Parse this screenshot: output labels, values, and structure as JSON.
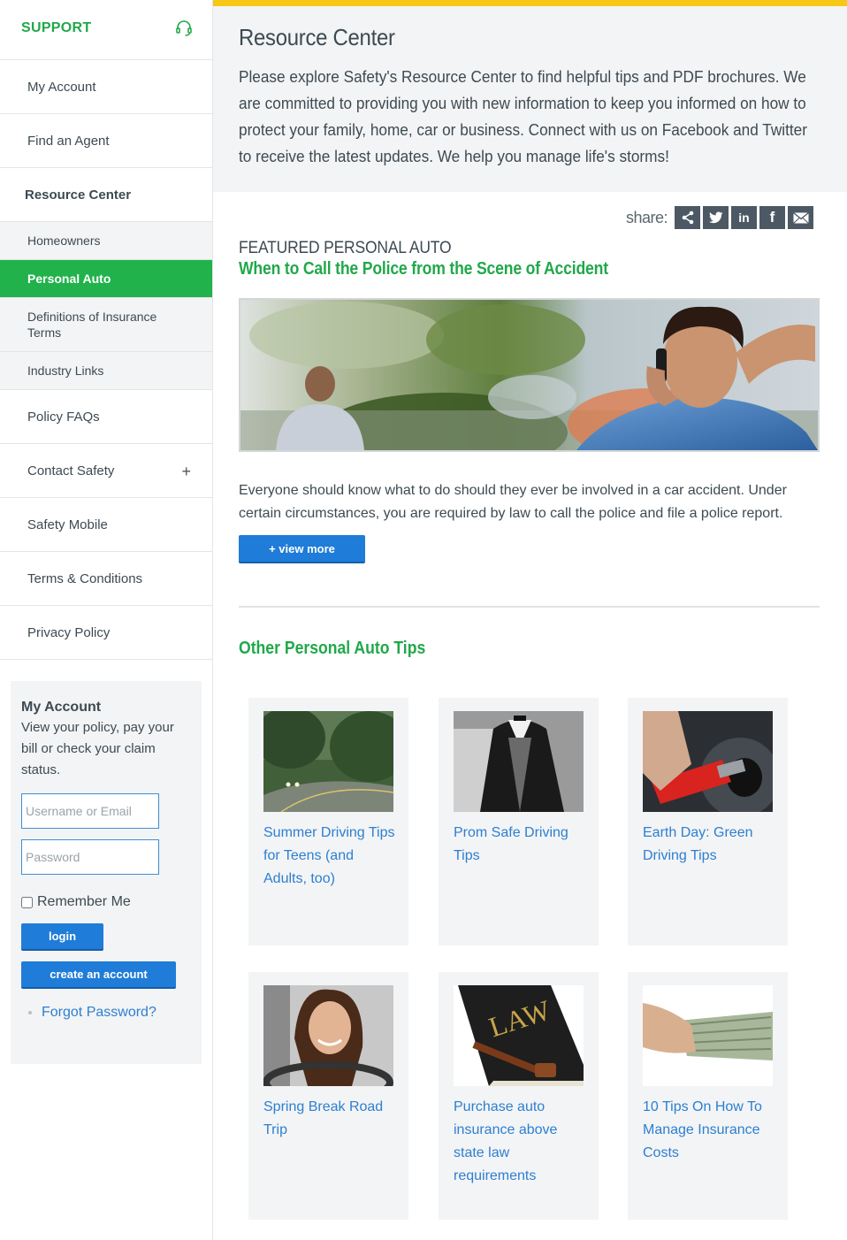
{
  "sidebar": {
    "support_label": "SUPPORT",
    "nav": {
      "my_account": "My Account",
      "find_agent": "Find an Agent",
      "resource_center": "Resource Center",
      "homeowners": "Homeowners",
      "personal_auto": "Personal Auto",
      "definitions": "Definitions of Insurance Terms",
      "industry_links": "Industry Links",
      "policy_faqs": "Policy FAQs",
      "contact_safety": "Contact Safety",
      "contact_expand": "+",
      "safety_mobile": "Safety Mobile",
      "terms": "Terms & Conditions",
      "privacy": "Privacy Policy"
    },
    "account": {
      "title": "My Account",
      "description": "View your policy, pay your bill or check your claim status.",
      "username_placeholder": "Username or Email",
      "password_placeholder": "Password",
      "remember_label": "Remember Me",
      "login_label": "login",
      "create_label": "create an account",
      "forgot_label": "Forgot Password?"
    }
  },
  "main": {
    "title": "Resource Center",
    "intro": "Please explore Safety's Resource Center to find helpful tips and PDF brochures. We are committed to providing you with new information to keep you informed on how to protect your family, home, car or business. Connect with us on Facebook and Twitter to receive the latest updates. We help you manage life's storms!",
    "share": {
      "label": "share:",
      "buttons": {
        "linkedin": "in",
        "facebook": "f"
      }
    },
    "featured": {
      "kicker": "FEATURED PERSONAL AUTO",
      "title": "When to Call the Police from the Scene of Accident",
      "description": "Everyone should know what to do should they ever be involved in a car accident. Under certain circumstances, you are required by law to call the police and file a police report.",
      "more_label": "+ view more"
    },
    "other_title": "Other Personal Auto Tips",
    "tips": [
      {
        "label": "Summer Driving Tips for Teens (and Adults, too)"
      },
      {
        "label": "Prom Safe Driving Tips"
      },
      {
        "label": "Earth Day: Green Driving Tips"
      },
      {
        "label": "Spring Break Road Trip"
      },
      {
        "label": "Purchase auto insurance above state law requirements"
      },
      {
        "label": "10 Tips On How To Manage Insurance Costs"
      }
    ],
    "law_book_text": "LAW"
  },
  "colors": {
    "brand_green": "#21a84a",
    "active_green": "#21b24b",
    "accent_yellow": "#f6c716",
    "button_blue": "#1f7cd8",
    "link_blue": "#2c7fd1"
  }
}
